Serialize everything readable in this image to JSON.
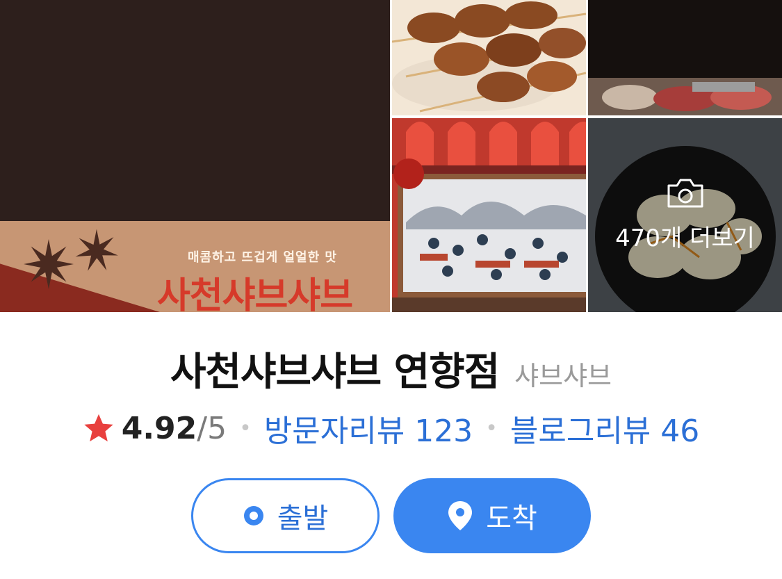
{
  "gallery": {
    "poster_tagline": "매콤하고 뜨겁게 얼얼한 맛",
    "poster_brand": "사천샤브샤브",
    "more_label": "470개 더보기"
  },
  "place": {
    "name": "사천샤브샤브 연향점",
    "category": "샤브샤브",
    "rating": "4.92",
    "rating_max": "/5",
    "visitor_reviews": "방문자리뷰 123",
    "blog_reviews": "블로그리뷰 46"
  },
  "actions": {
    "start_label": "출발",
    "arrive_label": "도착"
  },
  "colors": {
    "accent": "#3a86f0",
    "link": "#2b6fd6",
    "star": "#e8403e"
  }
}
